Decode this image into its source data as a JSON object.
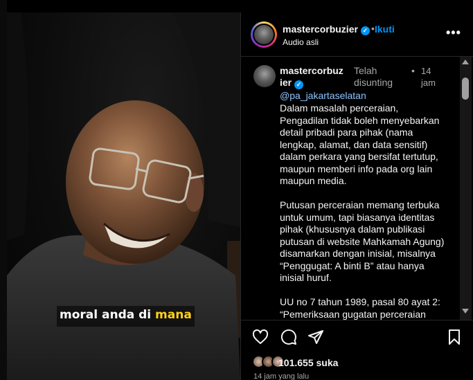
{
  "video": {
    "caption_part1": "moral anda di",
    "caption_part2": "mana",
    "caption_highlight_color": "#ffd21a"
  },
  "header": {
    "username": "mastercorbuzier",
    "verified_icon": "verified-badge-icon",
    "separator": "•",
    "follow_label": "Ikuti",
    "audio_label": "Audio asli",
    "more_icon": "more-options-icon"
  },
  "comment": {
    "username_line1": "mastercorbuz",
    "username_line2": "ier",
    "edited_line1": "Telah",
    "edited_line2": "disunting",
    "separator": "•",
    "time_line1": "14",
    "time_line2": "jam",
    "mention": "@pa_jakartaselatan",
    "body": "Dalam masalah perceraian, Pengadilan tidak boleh menyebarkan detail pribadi para pihak (nama lengkap, alamat, dan data sensitif) dalam perkara yang bersifat tertutup, maupun memberi info pada org lain maupun media.\n\nPutusan perceraian memang terbuka untuk umum, tapi biasanya identitas pihak (khususnya dalam publikasi putusan di website Mahkamah Agung) disamarkan dengan inisial, misalnya “Penggugat: A binti B” atau hanya inisial huruf.\n\nUU no 7 tahun 1989, pasal 80 ayat 2:\n“Pemeriksaan gugatan perceraian dilakukan dalam sidang tertutup.”"
  },
  "actions": {
    "like_icon": "heart-icon",
    "comment_icon": "comment-icon",
    "share_icon": "share-icon",
    "save_icon": "bookmark-icon",
    "likes_count": "101.655",
    "likes_label": "suka",
    "posted_ago": "14 jam yang lalu"
  },
  "colors": {
    "accent": "#0095f6",
    "background": "#000000",
    "muted_text": "#a8a8a8"
  }
}
